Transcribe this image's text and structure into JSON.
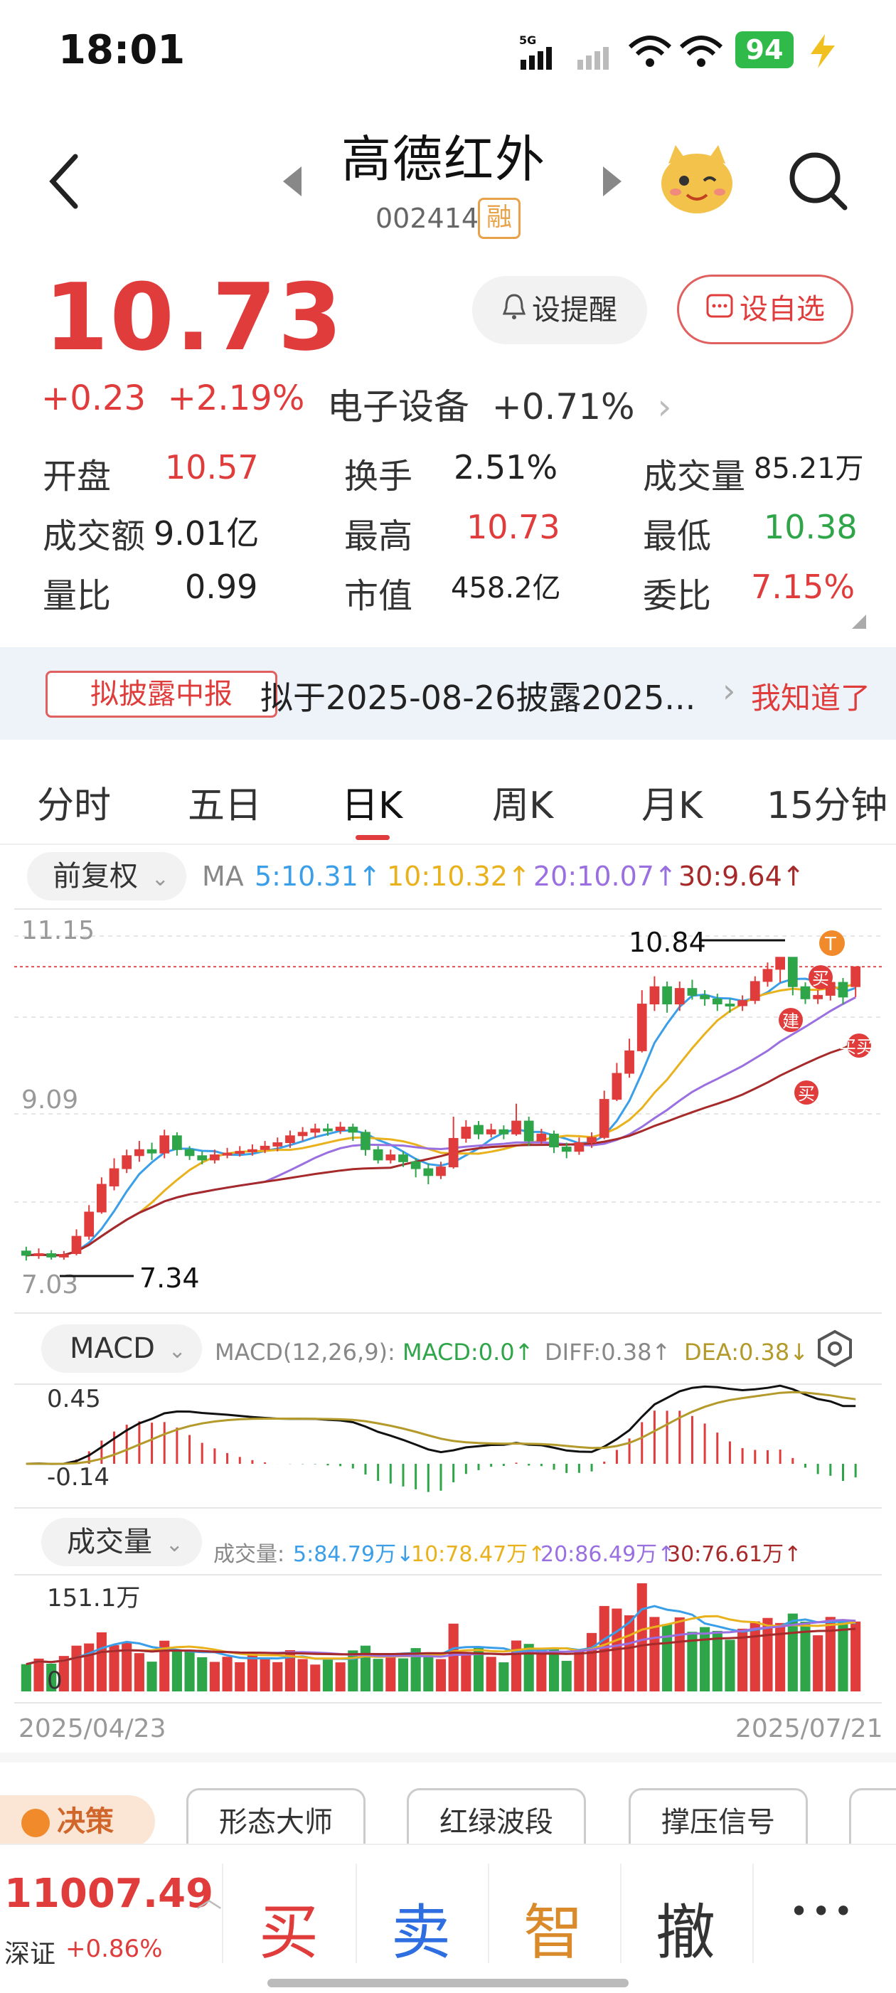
{
  "status_bar": {
    "time": "18:01",
    "network": "5G",
    "battery": "94"
  },
  "header": {
    "back_icon": "chevron-left-icon",
    "title": "高德红外",
    "code": "002414",
    "margin_badge": "融",
    "search_icon": "search-icon"
  },
  "quote": {
    "price": "10.73",
    "change": "+0.23",
    "change_pct": "+2.19%",
    "sector_name": "电子设备",
    "sector_change": "+0.71%",
    "alert_label": "设提醒",
    "watch_label": "设自选"
  },
  "stats": [
    {
      "label": "开盘",
      "value": "10.57",
      "color": "#e03c3c"
    },
    {
      "label": "换手",
      "value": "2.51%",
      "color": "#222222"
    },
    {
      "label": "成交量",
      "value": "85.21万",
      "color": "#222222"
    },
    {
      "label": "成交额",
      "value": "9.01亿",
      "color": "#222222"
    },
    {
      "label": "最高",
      "value": "10.73",
      "color": "#e03c3c"
    },
    {
      "label": "最低",
      "value": "10.38",
      "color": "#2fa54a"
    },
    {
      "label": "量比",
      "value": "0.99",
      "color": "#222222"
    },
    {
      "label": "市值",
      "value": "458.2亿",
      "color": "#222222"
    },
    {
      "label": "委比",
      "value": "7.15%",
      "color": "#e03c3c"
    }
  ],
  "banner": {
    "tag": "拟披露中报",
    "text": "拟于2025-08-26披露2025...",
    "ok": "我知道了"
  },
  "tabs": [
    "分时",
    "五日",
    "日K",
    "周K",
    "月K",
    "15分钟"
  ],
  "kline": {
    "adjust": "前复权",
    "ma_label": "MA",
    "ma5": "5:10.31↑",
    "ma10": "10:10.32↑",
    "ma20": "20:10.07↑",
    "ma30": "30:9.64↑",
    "y_top": "11.15",
    "y_mid": "9.09",
    "y_bottom": "7.03",
    "max_label": "10.84",
    "min_label": "7.34",
    "markers": {
      "t": "T",
      "buy": "买",
      "build": "建",
      "buy2": "买买"
    }
  },
  "macd": {
    "selector": "MACD",
    "params": "MACD(12,26,9):",
    "macd": "MACD:0.0↑",
    "diff": "DIFF:0.38↑",
    "dea": "DEA:0.38↓",
    "y_top": "0.45",
    "y_bottom": "-0.14"
  },
  "volume": {
    "selector": "成交量",
    "label": "成交量:",
    "v5": "5:84.79万↓",
    "v10": "10:78.47万↑",
    "v20": "20:86.49万↑",
    "v30": "30:76.61万↑",
    "y_top": "151.1万",
    "y_bottom": "0"
  },
  "dates": {
    "start": "2025/04/23",
    "end": "2025/07/21"
  },
  "decision": {
    "label": "决策",
    "tools": [
      "形态大师",
      "红绿波段",
      "撑压信号"
    ]
  },
  "bottom": {
    "index_value": "11007.49",
    "index_name": "深证",
    "index_change": "+0.86%",
    "buy": "买",
    "sell": "卖",
    "smart": "智",
    "cancel": "撤",
    "more": "•••"
  },
  "chart_data": {
    "type": "candlestick",
    "x": [
      "2025/04/23",
      "2025/07/21"
    ],
    "ylim": [
      7.03,
      11.15
    ],
    "candles": [
      {
        "o": 7.45,
        "c": 7.4,
        "h": 7.5,
        "l": 7.34
      },
      {
        "o": 7.4,
        "c": 7.42,
        "h": 7.48,
        "l": 7.36
      },
      {
        "o": 7.42,
        "c": 7.38,
        "h": 7.46,
        "l": 7.35
      },
      {
        "o": 7.38,
        "c": 7.41,
        "h": 7.45,
        "l": 7.35
      },
      {
        "o": 7.42,
        "c": 7.62,
        "h": 7.7,
        "l": 7.4
      },
      {
        "o": 7.62,
        "c": 7.9,
        "h": 7.98,
        "l": 7.58
      },
      {
        "o": 7.9,
        "c": 8.22,
        "h": 8.3,
        "l": 7.88
      },
      {
        "o": 8.2,
        "c": 8.4,
        "h": 8.52,
        "l": 8.15
      },
      {
        "o": 8.4,
        "c": 8.55,
        "h": 8.62,
        "l": 8.35
      },
      {
        "o": 8.55,
        "c": 8.62,
        "h": 8.72,
        "l": 8.48
      },
      {
        "o": 8.62,
        "c": 8.58,
        "h": 8.7,
        "l": 8.5
      },
      {
        "o": 8.58,
        "c": 8.78,
        "h": 8.85,
        "l": 8.52
      },
      {
        "o": 8.78,
        "c": 8.62,
        "h": 8.82,
        "l": 8.55
      },
      {
        "o": 8.62,
        "c": 8.55,
        "h": 8.66,
        "l": 8.5
      },
      {
        "o": 8.55,
        "c": 8.5,
        "h": 8.6,
        "l": 8.45
      },
      {
        "o": 8.5,
        "c": 8.56,
        "h": 8.62,
        "l": 8.46
      },
      {
        "o": 8.56,
        "c": 8.58,
        "h": 8.64,
        "l": 8.52
      },
      {
        "o": 8.58,
        "c": 8.6,
        "h": 8.66,
        "l": 8.54
      },
      {
        "o": 8.6,
        "c": 8.62,
        "h": 8.68,
        "l": 8.55
      },
      {
        "o": 8.62,
        "c": 8.66,
        "h": 8.72,
        "l": 8.58
      },
      {
        "o": 8.66,
        "c": 8.7,
        "h": 8.76,
        "l": 8.6
      },
      {
        "o": 8.7,
        "c": 8.78,
        "h": 8.84,
        "l": 8.64
      },
      {
        "o": 8.78,
        "c": 8.82,
        "h": 8.88,
        "l": 8.72
      },
      {
        "o": 8.82,
        "c": 8.86,
        "h": 8.92,
        "l": 8.76
      },
      {
        "o": 8.86,
        "c": 8.84,
        "h": 8.92,
        "l": 8.78
      },
      {
        "o": 8.84,
        "c": 8.88,
        "h": 8.94,
        "l": 8.8
      },
      {
        "o": 8.88,
        "c": 8.82,
        "h": 8.92,
        "l": 8.72
      },
      {
        "o": 8.82,
        "c": 8.62,
        "h": 8.85,
        "l": 8.55
      },
      {
        "o": 8.62,
        "c": 8.5,
        "h": 8.66,
        "l": 8.46
      },
      {
        "o": 8.5,
        "c": 8.56,
        "h": 8.62,
        "l": 8.46
      },
      {
        "o": 8.56,
        "c": 8.48,
        "h": 8.6,
        "l": 8.42
      },
      {
        "o": 8.48,
        "c": 8.4,
        "h": 8.52,
        "l": 8.3
      },
      {
        "o": 8.4,
        "c": 8.32,
        "h": 8.46,
        "l": 8.22
      },
      {
        "o": 8.32,
        "c": 8.42,
        "h": 8.48,
        "l": 8.28
      },
      {
        "o": 8.42,
        "c": 8.75,
        "h": 9.0,
        "l": 8.4
      },
      {
        "o": 8.75,
        "c": 8.88,
        "h": 8.96,
        "l": 8.7
      },
      {
        "o": 8.9,
        "c": 8.8,
        "h": 8.95,
        "l": 8.74
      },
      {
        "o": 8.8,
        "c": 8.85,
        "h": 8.92,
        "l": 8.76
      },
      {
        "o": 8.85,
        "c": 8.8,
        "h": 8.9,
        "l": 8.74
      },
      {
        "o": 8.8,
        "c": 8.95,
        "h": 9.15,
        "l": 8.78
      },
      {
        "o": 8.95,
        "c": 8.72,
        "h": 9.0,
        "l": 8.66
      },
      {
        "o": 8.72,
        "c": 8.8,
        "h": 8.86,
        "l": 8.68
      },
      {
        "o": 8.8,
        "c": 8.65,
        "h": 8.84,
        "l": 8.58
      },
      {
        "o": 8.65,
        "c": 8.6,
        "h": 8.7,
        "l": 8.52
      },
      {
        "o": 8.6,
        "c": 8.7,
        "h": 8.76,
        "l": 8.56
      },
      {
        "o": 8.7,
        "c": 8.76,
        "h": 8.82,
        "l": 8.64
      },
      {
        "o": 8.76,
        "c": 9.2,
        "h": 9.3,
        "l": 8.74
      },
      {
        "o": 9.2,
        "c": 9.5,
        "h": 9.62,
        "l": 9.18
      },
      {
        "o": 9.5,
        "c": 9.76,
        "h": 9.9,
        "l": 9.45
      },
      {
        "o": 9.76,
        "c": 10.3,
        "h": 10.46,
        "l": 9.74
      },
      {
        "o": 10.3,
        "c": 10.5,
        "h": 10.62,
        "l": 10.22
      },
      {
        "o": 10.5,
        "c": 10.3,
        "h": 10.56,
        "l": 10.2
      },
      {
        "o": 10.3,
        "c": 10.48,
        "h": 10.56,
        "l": 10.22
      },
      {
        "o": 10.48,
        "c": 10.4,
        "h": 10.58,
        "l": 10.35
      },
      {
        "o": 10.4,
        "c": 10.36,
        "h": 10.46,
        "l": 10.28
      },
      {
        "o": 10.36,
        "c": 10.3,
        "h": 10.42,
        "l": 10.22
      },
      {
        "o": 10.3,
        "c": 10.28,
        "h": 10.36,
        "l": 10.2
      },
      {
        "o": 10.28,
        "c": 10.34,
        "h": 10.4,
        "l": 10.22
      },
      {
        "o": 10.34,
        "c": 10.56,
        "h": 10.62,
        "l": 10.3
      },
      {
        "o": 10.56,
        "c": 10.7,
        "h": 10.78,
        "l": 10.5
      },
      {
        "o": 10.7,
        "c": 10.84,
        "h": 10.84,
        "l": 10.55
      },
      {
        "o": 10.84,
        "c": 10.5,
        "h": 10.84,
        "l": 10.4
      },
      {
        "o": 10.5,
        "c": 10.36,
        "h": 10.55,
        "l": 10.3
      },
      {
        "o": 10.36,
        "c": 10.4,
        "h": 10.46,
        "l": 10.3
      },
      {
        "o": 10.4,
        "c": 10.55,
        "h": 10.62,
        "l": 10.34
      },
      {
        "o": 10.55,
        "c": 10.38,
        "h": 10.6,
        "l": 10.3
      },
      {
        "o": 10.5,
        "c": 10.73,
        "h": 10.73,
        "l": 10.38
      }
    ]
  }
}
